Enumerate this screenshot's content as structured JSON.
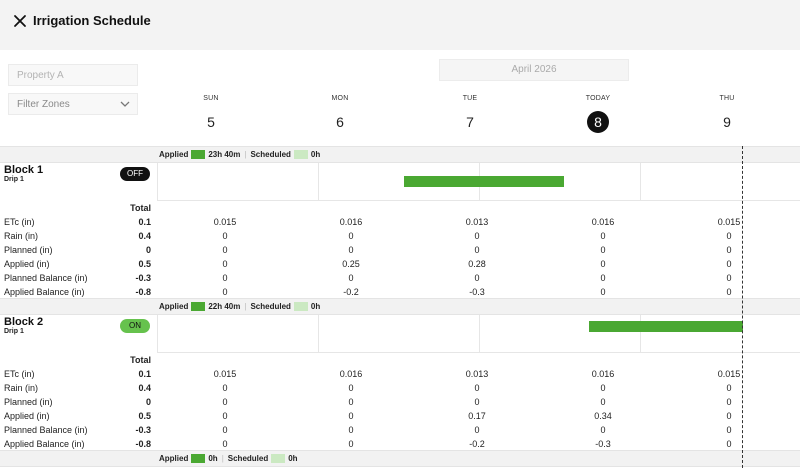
{
  "header": {
    "title": "Irrigation Schedule",
    "close_icon": "close-icon"
  },
  "filters": {
    "property_placeholder": "Property A",
    "zones_label": "Filter Zones"
  },
  "calendar": {
    "month_label": "April 2026",
    "days": [
      {
        "name": "SUN",
        "number": "5",
        "today": false
      },
      {
        "name": "MON",
        "number": "6",
        "today": false
      },
      {
        "name": "TUE",
        "number": "7",
        "today": false
      },
      {
        "name": "TODAY",
        "number": "8",
        "today": true
      },
      {
        "name": "THU",
        "number": "9",
        "today": false
      }
    ]
  },
  "colors": {
    "applied": "#4aa832",
    "scheduled": "#cbe9c2",
    "toggle_on": "#66c24d",
    "toggle_off": "#111111"
  },
  "total_label": "Total",
  "blocks": [
    {
      "name": "Block 1",
      "subtitle": "Drip 1",
      "toggle": "OFF",
      "legend": {
        "applied_label": "Applied",
        "applied_value": "23h 40m",
        "scheduled_label": "Scheduled",
        "scheduled_value": "0h"
      },
      "metrics": [
        {
          "label": "ETc (in)",
          "total": "0.1",
          "values": [
            "0.015",
            "0.016",
            "0.013",
            "0.016",
            "0.015"
          ]
        },
        {
          "label": "Rain (in)",
          "total": "0.4",
          "values": [
            "0",
            "0",
            "0",
            "0",
            "0"
          ]
        },
        {
          "label": "Planned (in)",
          "total": "0",
          "values": [
            "0",
            "0",
            "0",
            "0",
            "0"
          ]
        },
        {
          "label": "Applied (in)",
          "total": "0.5",
          "values": [
            "0",
            "0.25",
            "0.28",
            "0",
            "0"
          ]
        },
        {
          "label": "Planned Balance (in)",
          "total": "-0.3",
          "values": [
            "0",
            "0",
            "0",
            "0",
            "0"
          ]
        },
        {
          "label": "Applied Balance (in)",
          "total": "-0.8",
          "values": [
            "0",
            "-0.2",
            "-0.3",
            "0",
            "0"
          ]
        }
      ]
    },
    {
      "name": "Block 2",
      "subtitle": "Drip 1",
      "toggle": "ON",
      "legend": {
        "applied_label": "Applied",
        "applied_value": "22h 40m",
        "scheduled_label": "Scheduled",
        "scheduled_value": "0h"
      },
      "metrics": [
        {
          "label": "ETc (in)",
          "total": "0.1",
          "values": [
            "0.015",
            "0.016",
            "0.013",
            "0.016",
            "0.015"
          ]
        },
        {
          "label": "Rain (in)",
          "total": "0.4",
          "values": [
            "0",
            "0",
            "0",
            "0",
            "0"
          ]
        },
        {
          "label": "Planned (in)",
          "total": "0",
          "values": [
            "0",
            "0",
            "0",
            "0",
            "0"
          ]
        },
        {
          "label": "Applied (in)",
          "total": "0.5",
          "values": [
            "0",
            "0",
            "0.17",
            "0.34",
            "0"
          ]
        },
        {
          "label": "Planned Balance (in)",
          "total": "-0.3",
          "values": [
            "0",
            "0",
            "0",
            "0",
            "0"
          ]
        },
        {
          "label": "Applied Balance (in)",
          "total": "-0.8",
          "values": [
            "0",
            "0",
            "-0.2",
            "-0.3",
            "0"
          ]
        }
      ]
    }
  ],
  "next_legend": {
    "applied_label": "Applied",
    "applied_value": "0h",
    "scheduled_label": "Scheduled",
    "scheduled_value": "0h"
  }
}
